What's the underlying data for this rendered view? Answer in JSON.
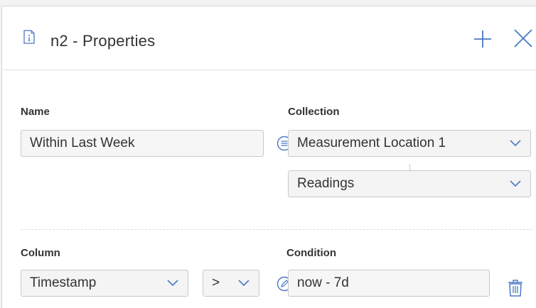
{
  "header": {
    "title": "n2 - Properties"
  },
  "form": {
    "name_label": "Name",
    "name_value": "Within Last Week",
    "collection_label": "Collection",
    "collection_value": "Measurement Location 1",
    "subcollection_value": "Readings",
    "column_label": "Column",
    "column_value": "Timestamp",
    "operator_value": ">",
    "condition_label": "Condition",
    "condition_value": "now - 7d"
  },
  "colors": {
    "accent": "#4a78c6",
    "border": "#c9c9c9",
    "field_bg": "#f6f6f6"
  },
  "icons": {
    "doc": "document-info-icon",
    "add": "plus-icon",
    "close": "close-icon",
    "collection": "list-circle-icon",
    "condition": "edit-pencil-circle-icon",
    "delete": "trash-icon"
  }
}
